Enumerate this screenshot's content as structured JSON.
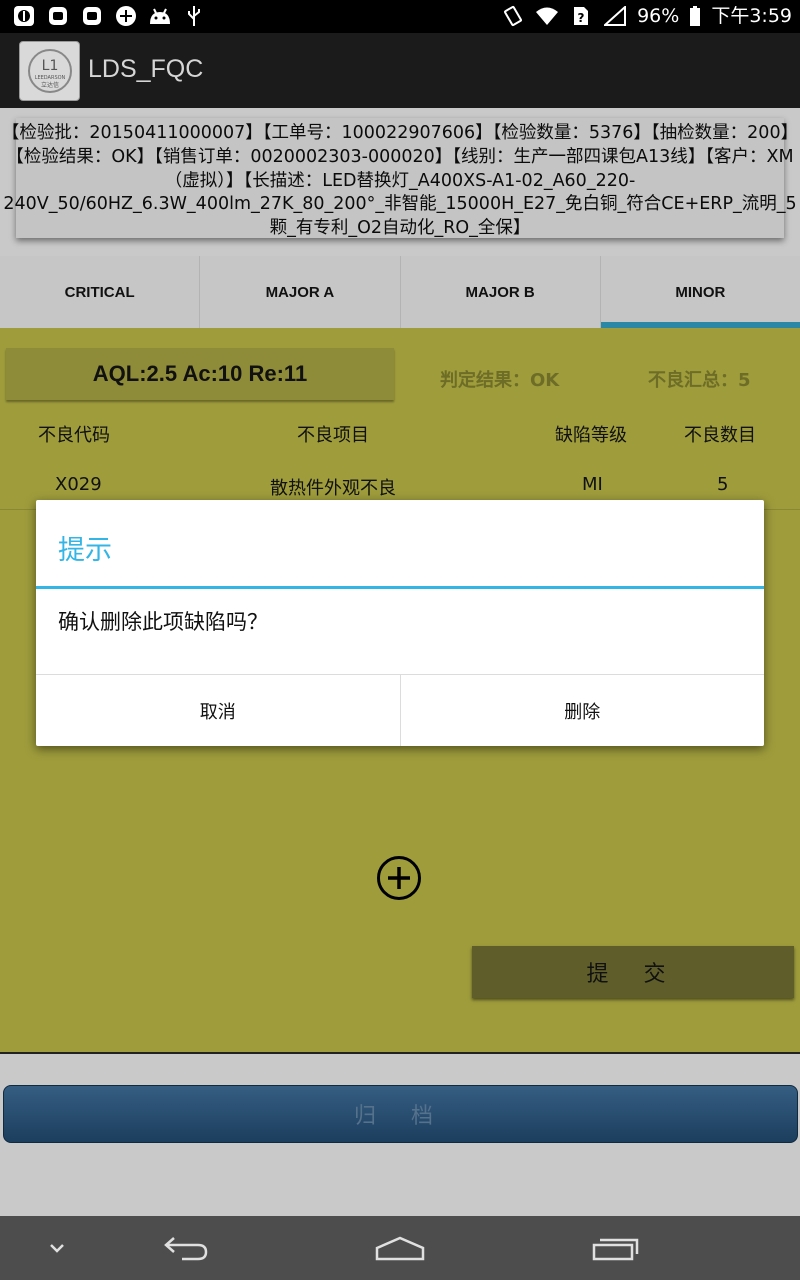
{
  "status_bar": {
    "battery": "96%",
    "time": "下午3:59",
    "sim_icon": "?"
  },
  "app": {
    "title": "LDS_FQC",
    "logo_text": "LEEDARSON",
    "logo_cn": "立达信"
  },
  "info": {
    "text": "【检验批：20150411000007】【工单号：100022907606】【检验数量：5376】【抽检数量：200】【检验结果：OK】【销售订单：0020002303-000020】【线别：生产一部四课包A13线】【客户：XM（虚拟）】【长描述：LED替换灯_A400XS-A1-02_A60_220-240V_50/60HZ_6.3W_400lm_27K_80_200°_非智能_15000H_E27_免白铜_符合CE+ERP_流明_5颗_有专利_O2自动化_RO_全保】"
  },
  "tabs": [
    {
      "label": "CRITICAL",
      "active": false
    },
    {
      "label": "MAJOR A",
      "active": false
    },
    {
      "label": "MAJOR B",
      "active": false
    },
    {
      "label": "MINOR",
      "active": true
    }
  ],
  "content": {
    "aql": "AQL:2.5 Ac:10 Re:11",
    "judge": "判定结果：OK",
    "summary": "不良汇总：5",
    "columns": [
      "不良代码",
      "不良项目",
      "缺陷等级",
      "不良数目"
    ],
    "rows": [
      {
        "code": "X029",
        "item": "散热件外观不良",
        "level": "MI",
        "count": "5"
      }
    ],
    "submit_label": "提 交"
  },
  "archive_label": "归 档",
  "dialog": {
    "title": "提示",
    "message": "确认删除此项缺陷吗？",
    "cancel": "取消",
    "confirm": "删除"
  },
  "colors": {
    "accent": "#33b5e5",
    "tab_indicator": "#2a87a6",
    "content_bg": "#9e9c3b"
  }
}
